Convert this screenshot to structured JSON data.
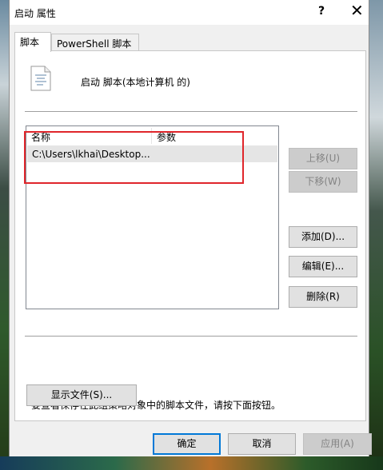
{
  "window": {
    "title": "启动 属性",
    "help_glyph": "?",
    "close_glyph": "✕"
  },
  "tabs": [
    {
      "label": "脚本",
      "active": true
    },
    {
      "label": "PowerShell 脚本",
      "active": false
    }
  ],
  "header": {
    "icon": "script-document-icon",
    "label": "启动 脚本(本地计算机 的)"
  },
  "script_list": {
    "columns": [
      "名称",
      "参数"
    ],
    "rows": [
      {
        "name": "C:\\Users\\lkhai\\Desktop...",
        "params": ""
      }
    ]
  },
  "side_buttons": {
    "up": "上移(U)",
    "down": "下移(W)",
    "add": "添加(D)...",
    "edit": "编辑(E)...",
    "remove": "删除(R)"
  },
  "info": {
    "text": "要查看保存在此组策略对象中的脚本文件，请按下面按钮。",
    "show_files_button": "显示文件(S)..."
  },
  "footer": {
    "ok": "确定",
    "cancel": "取消",
    "apply": "应用(A)"
  },
  "colors": {
    "highlight_border": "#e0262b",
    "default_button_border": "#0078d7"
  }
}
